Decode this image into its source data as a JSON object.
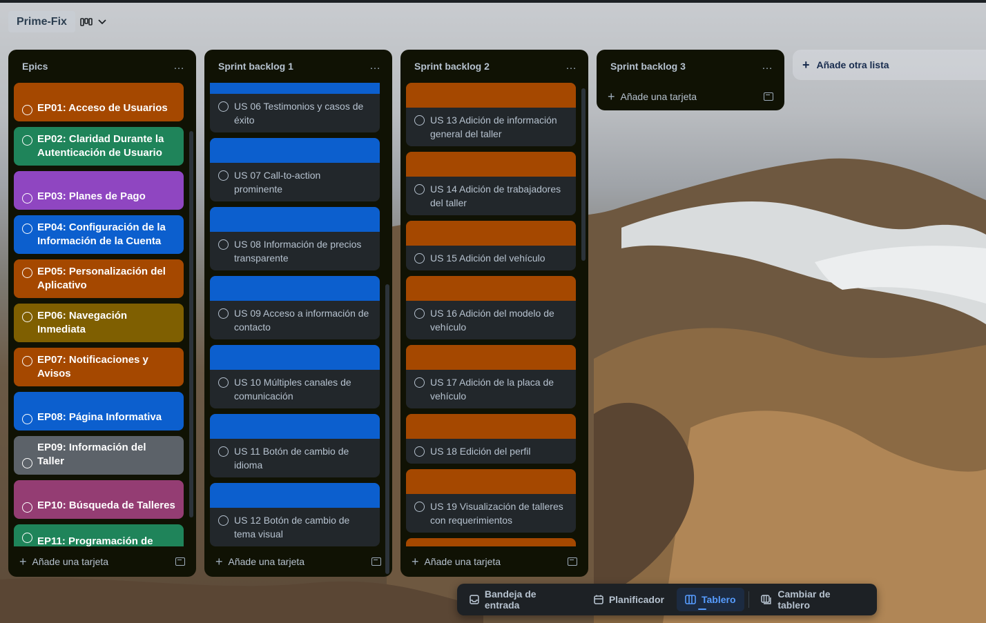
{
  "board": {
    "name": "Prime-Fix",
    "view_chevron": "chevron-down-icon"
  },
  "colors": {
    "orange": "#a54800",
    "green": "#1f845a",
    "purple": "#8f46c1",
    "blue": "#0c5fce",
    "olive": "#7f5f01",
    "gray": "#5c6269",
    "magenta": "#943d73",
    "list_bg": "#101204",
    "card_bg": "#22272b"
  },
  "lists": [
    {
      "title": "Epics",
      "footer": "Añade una tarjeta",
      "cards": [
        {
          "title": "EP01: Acceso de Usuarios",
          "color": "#a54800"
        },
        {
          "title": "EP02: Claridad Durante la Autenticación de Usuario",
          "color": "#1f845a"
        },
        {
          "title": "EP03: Planes de Pago",
          "color": "#8f46c1"
        },
        {
          "title": "EP04: Configuración de la Información de la Cuenta",
          "color": "#0c5fce"
        },
        {
          "title": "EP05: Personalización del Aplicativo",
          "color": "#a54800"
        },
        {
          "title": "EP06: Navegación Inmediata",
          "color": "#7f5f01"
        },
        {
          "title": "EP07: Notificaciones y Avisos",
          "color": "#a54800"
        },
        {
          "title": "EP08: Página Informativa",
          "color": "#0c5fce"
        },
        {
          "title": "EP09: Información del Taller",
          "color": "#5c6269"
        },
        {
          "title": "EP10: Búsqueda de Talleres",
          "color": "#943d73"
        },
        {
          "title": "EP11: Programación de",
          "color": "#1f845a"
        }
      ]
    },
    {
      "title": "Sprint backlog 1",
      "footer": "Añade una tarjeta",
      "cards": [
        {
          "title": "US 06 Testimonios y casos de éxito",
          "cover": "#0c5fce"
        },
        {
          "title": "US 07 Call-to-action prominente",
          "cover": "#0c5fce"
        },
        {
          "title": "US 08 Información de precios transparente",
          "cover": "#0c5fce"
        },
        {
          "title": "US 09 Acceso a información de contacto",
          "cover": "#0c5fce"
        },
        {
          "title": "US 10 Múltiples canales de comunicación",
          "cover": "#0c5fce"
        },
        {
          "title": "US 11 Botón de cambio de idioma",
          "cover": "#0c5fce"
        },
        {
          "title": "US 12 Botón de cambio de tema visual",
          "cover": "#0c5fce"
        }
      ]
    },
    {
      "title": "Sprint backlog 2",
      "footer": "Añade una tarjeta",
      "cards": [
        {
          "title": "US 13 Adición de información general del taller",
          "cover": "#a54800"
        },
        {
          "title": "US 14 Adición de trabajadores del taller",
          "cover": "#a54800"
        },
        {
          "title": "US 15 Adición del vehículo",
          "cover": "#a54800"
        },
        {
          "title": "US 16 Adición del modelo de vehículo",
          "cover": "#a54800"
        },
        {
          "title": "US 17 Adición de la placa de vehículo",
          "cover": "#a54800"
        },
        {
          "title": "US 18 Edición del perfil",
          "cover": "#a54800"
        },
        {
          "title": "US 19 Visualización de talleres con requerimientos",
          "cover": "#a54800"
        }
      ]
    },
    {
      "title": "Sprint backlog 3",
      "footer": "Añade una tarjeta",
      "cards": []
    }
  ],
  "add_list": "Añade otra lista",
  "bottom_nav": {
    "inbox": "Bandeja de entrada",
    "planner": "Planificador",
    "board": "Tablero",
    "switch": "Cambiar de tablero"
  },
  "list_menu_icon": "…"
}
